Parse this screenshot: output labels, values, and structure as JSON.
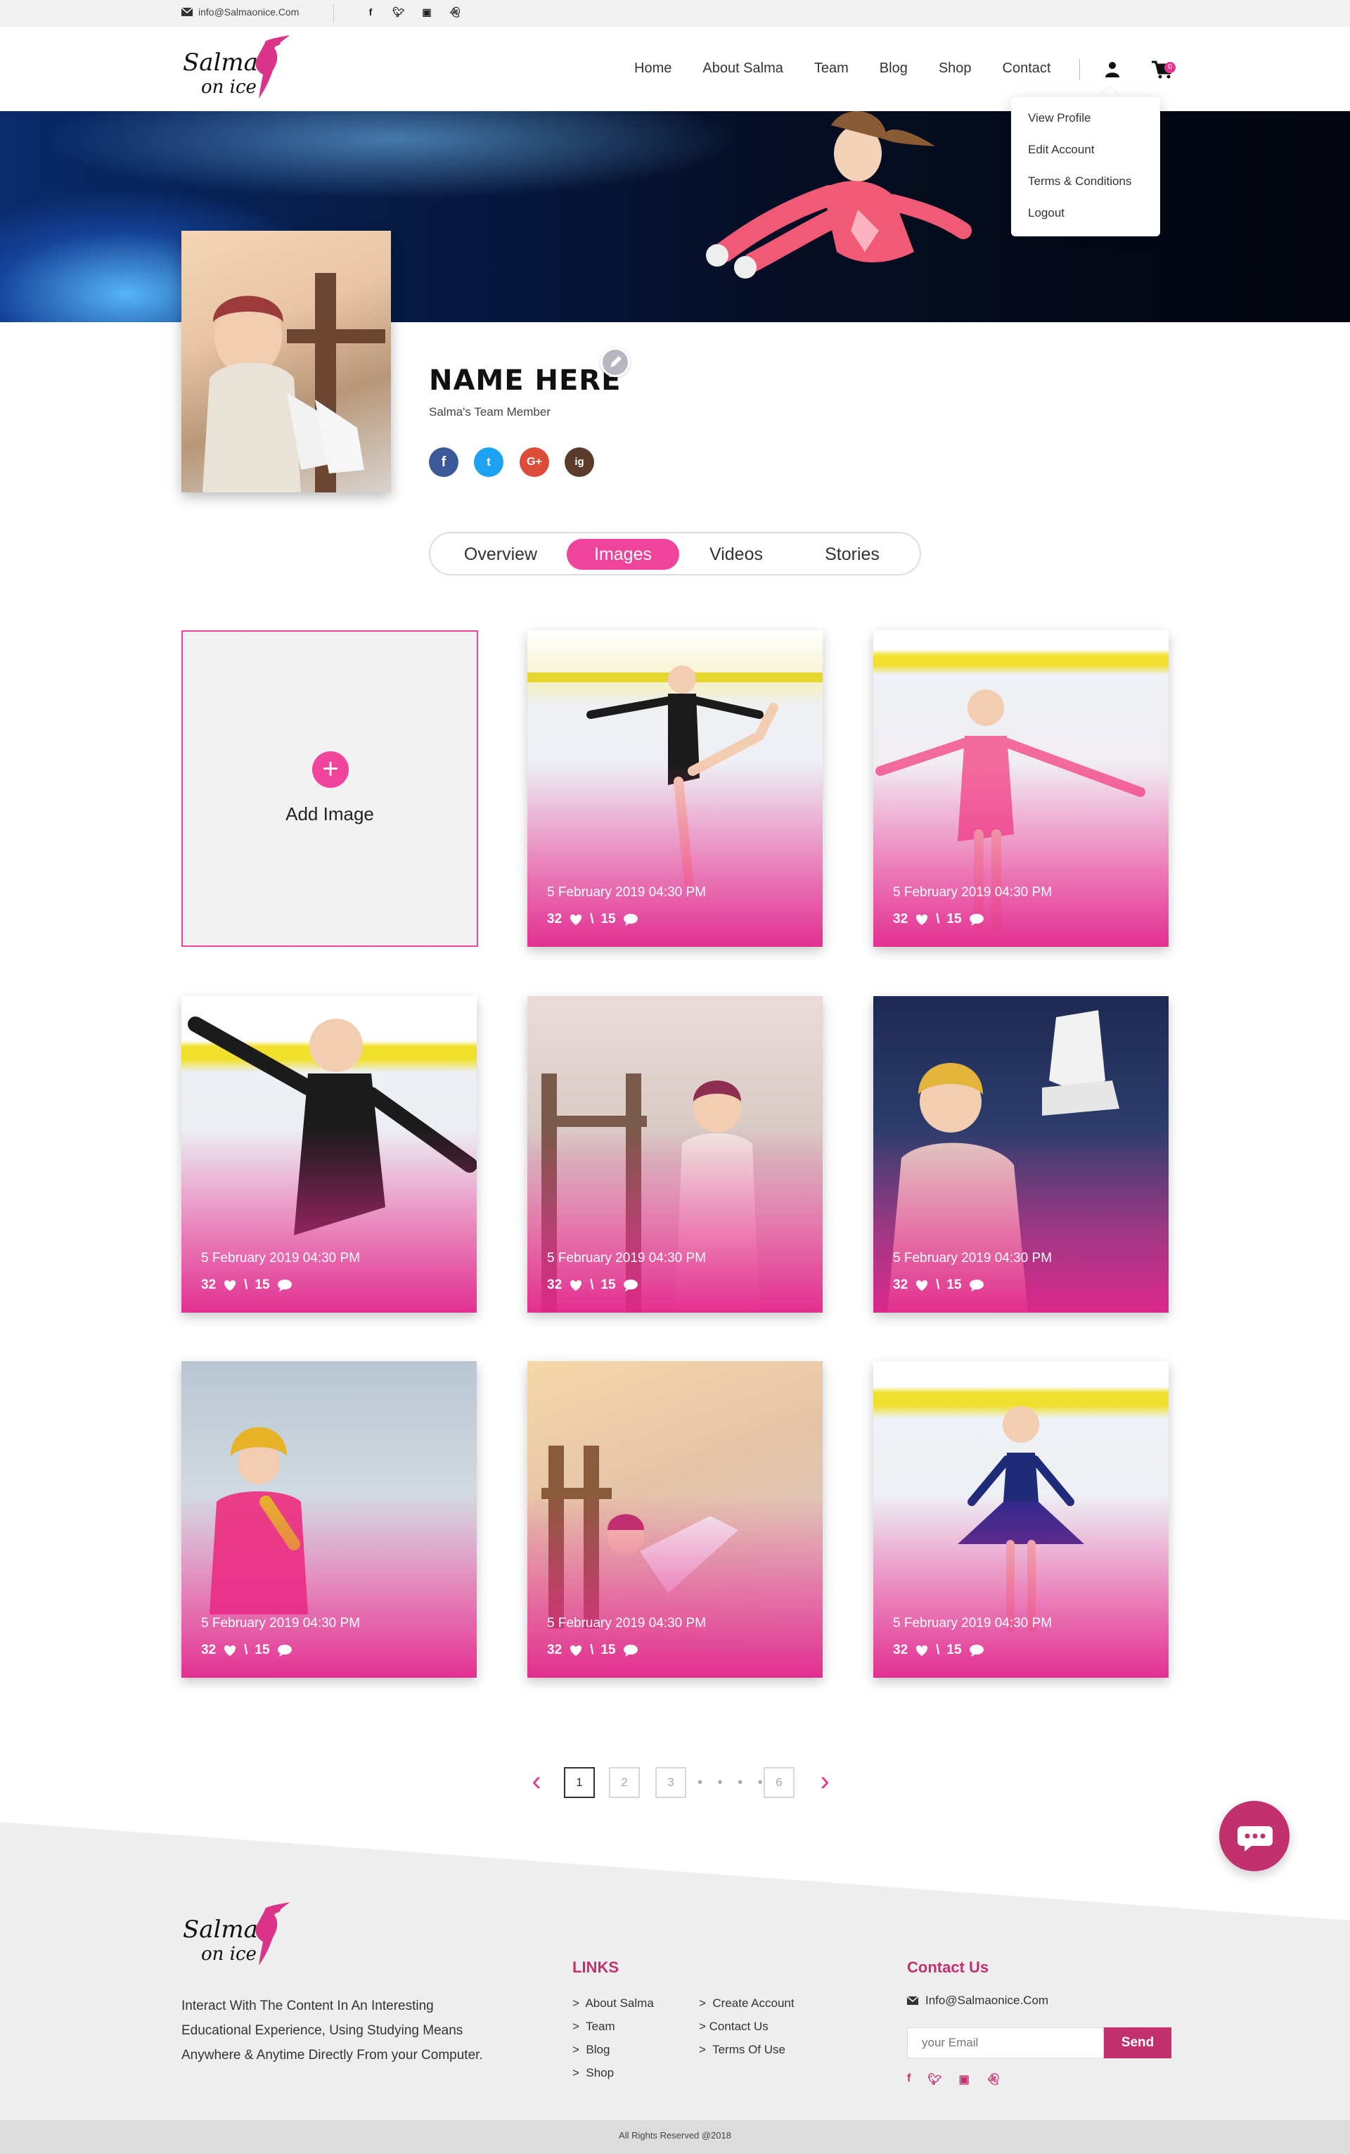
{
  "topbar": {
    "email": "info@Salmaonice.Com",
    "social": [
      "f",
      "t",
      "ig",
      "sc"
    ]
  },
  "brand": {
    "line1": "Salma",
    "line2": "on ice"
  },
  "nav": {
    "items": [
      "Home",
      "About Salma",
      "Team",
      "Blog",
      "Shop",
      "Contact"
    ],
    "cart_count": "0"
  },
  "dropdown": {
    "items": [
      "View Profile",
      "Edit Account",
      "Terms & Conditions",
      "Logout"
    ]
  },
  "profile": {
    "name": "NAME HERE",
    "role": "Salma's Team Member",
    "social": [
      "f",
      "t",
      "G+",
      "ig"
    ]
  },
  "tabs": [
    {
      "label": "Overview",
      "active": false
    },
    {
      "label": "Images",
      "active": true
    },
    {
      "label": "Videos",
      "active": false
    },
    {
      "label": "Stories",
      "active": false
    }
  ],
  "add_image": {
    "label": "Add Image",
    "icon": "plus-icon"
  },
  "gallery": [
    {
      "date": "5 February 2019   04:30 PM",
      "likes": "32",
      "sep": "\\",
      "comments": "15"
    },
    {
      "date": "5 February 2019   04:30 PM",
      "likes": "32",
      "sep": "\\",
      "comments": "15"
    },
    {
      "date": "5 February 2019   04:30 PM",
      "likes": "32",
      "sep": "\\",
      "comments": "15"
    },
    {
      "date": "5 February 2019   04:30 PM",
      "likes": "32",
      "sep": "\\",
      "comments": "15"
    },
    {
      "date": "5 February 2019   04:30 PM",
      "likes": "32",
      "sep": "\\",
      "comments": "15"
    },
    {
      "date": "5 February 2019   04:30 PM",
      "likes": "32",
      "sep": "\\",
      "comments": "15"
    },
    {
      "date": "5 February 2019   04:30 PM",
      "likes": "32",
      "sep": "\\",
      "comments": "15"
    },
    {
      "date": "5 February 2019   04:30 PM",
      "likes": "32",
      "sep": "\\",
      "comments": "15"
    }
  ],
  "pagination": {
    "pages": [
      "1",
      "2",
      "3",
      "6"
    ],
    "dots": "• • • •",
    "current": "1"
  },
  "footer": {
    "description": "Interact With The Content In An Interesting Educational Experience, Using Studying Means Anywhere & Anytime Directly From your Computer.",
    "links_title": "LINKS",
    "links_col1": [
      "About Salma",
      "Team",
      "Blog",
      "Shop"
    ],
    "links_col2": [
      "Create Account",
      "Contact Us",
      "Terms Of Use"
    ],
    "contact_title": "Contact Us",
    "contact_email": "Info@Salmaonice.Com",
    "email_placeholder": "your Email",
    "send_label": "Send",
    "social": [
      "f",
      "t",
      "ig",
      "sc"
    ],
    "copyright": "All Rights Reserved @2018"
  },
  "colors": {
    "accent": "#f0439b",
    "brand": "#c2306e"
  }
}
